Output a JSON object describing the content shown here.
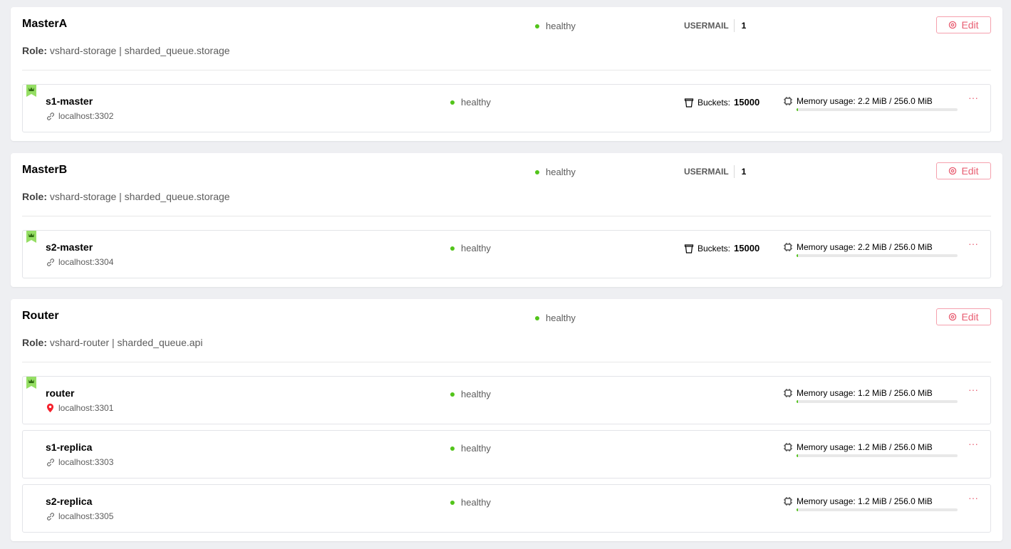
{
  "colors": {
    "healthy": "#52c41a",
    "accent": "#f5222d",
    "leader": "#95de64"
  },
  "replicasets": [
    {
      "name": "MasterA",
      "status": "healthy",
      "group": "USERMAIL",
      "weight": "1",
      "edit_label": "Edit",
      "role_label": "Role:",
      "roles": "vshard-storage | sharded_queue.storage",
      "servers": [
        {
          "alias": "s1-master",
          "uri": "localhost:3302",
          "uri_icon": "link-icon",
          "status": "healthy",
          "leader": true,
          "buckets_label": "Buckets:",
          "buckets": "15000",
          "memory_text": "Memory usage: 2.2 MiB / 256.0 MiB",
          "memory_fraction": 0.01,
          "more": "···"
        }
      ]
    },
    {
      "name": "MasterB",
      "status": "healthy",
      "group": "USERMAIL",
      "weight": "1",
      "edit_label": "Edit",
      "role_label": "Role:",
      "roles": "vshard-storage | sharded_queue.storage",
      "servers": [
        {
          "alias": "s2-master",
          "uri": "localhost:3304",
          "uri_icon": "link-icon",
          "status": "healthy",
          "leader": true,
          "buckets_label": "Buckets:",
          "buckets": "15000",
          "memory_text": "Memory usage: 2.2 MiB / 256.0 MiB",
          "memory_fraction": 0.01,
          "more": "···"
        }
      ]
    },
    {
      "name": "Router",
      "status": "healthy",
      "edit_label": "Edit",
      "role_label": "Role:",
      "roles": "vshard-router | sharded_queue.api",
      "servers": [
        {
          "alias": "router",
          "uri": "localhost:3301",
          "uri_icon": "location-pin-icon",
          "status": "healthy",
          "leader": true,
          "memory_text": "Memory usage: 1.2 MiB / 256.0 MiB",
          "memory_fraction": 0.01,
          "more": "···"
        },
        {
          "alias": "s1-replica",
          "uri": "localhost:3303",
          "uri_icon": "link-icon",
          "status": "healthy",
          "leader": false,
          "memory_text": "Memory usage: 1.2 MiB / 256.0 MiB",
          "memory_fraction": 0.01,
          "more": "···"
        },
        {
          "alias": "s2-replica",
          "uri": "localhost:3305",
          "uri_icon": "link-icon",
          "status": "healthy",
          "leader": false,
          "memory_text": "Memory usage: 1.2 MiB / 256.0 MiB",
          "memory_fraction": 0.01,
          "more": "···"
        }
      ]
    }
  ]
}
